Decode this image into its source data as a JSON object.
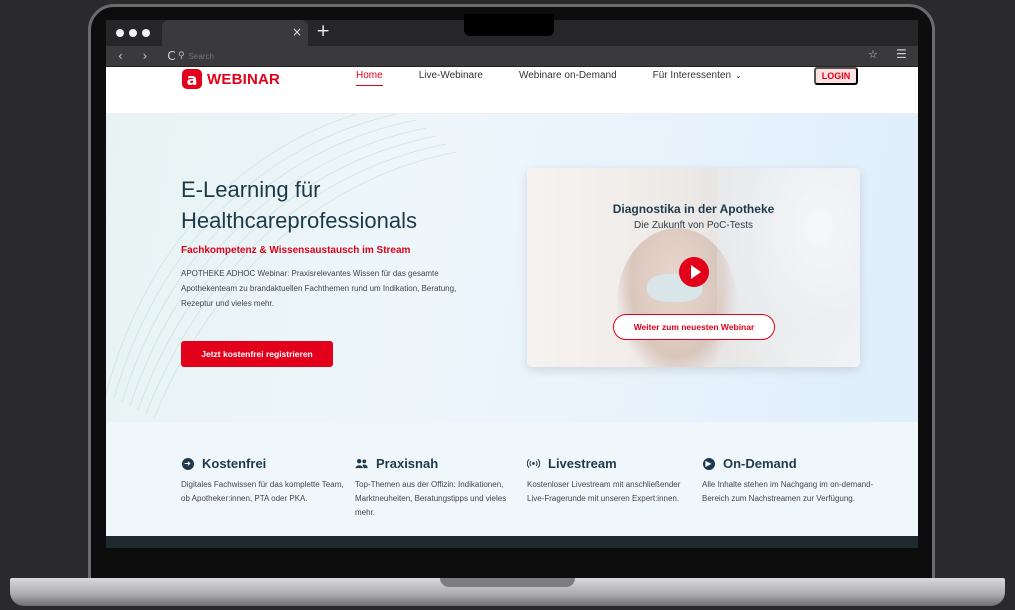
{
  "browser": {
    "tab_close": "×",
    "new_tab": "+",
    "nav_buttons": "‹ › C",
    "search_placeholder": "Search"
  },
  "header": {
    "logo_mark": "a",
    "logo_text": "WEBINAR",
    "nav": [
      {
        "label": "Home",
        "active": true
      },
      {
        "label": "Live-Webinare"
      },
      {
        "label": "Webinare on-Demand"
      },
      {
        "label": "Für Interessenten"
      }
    ],
    "login_label": "LOGIN"
  },
  "hero": {
    "title_line1": "E-Learning für",
    "title_line2": "Healthcareprofessionals",
    "subtitle": "Fachkompetenz & Wissensaustausch im Stream",
    "description": "APOTHEKE ADHOC Webinar: Praxisrelevantes Wissen für das gesamte Apothekenteam zu brandaktuellen Fachthemen rund um Indikation, Beratung, Rezeptur und vieles mehr.",
    "cta_label": "Jetzt kostenfrei registrieren"
  },
  "video": {
    "title": "Diagnostika in der Apotheke",
    "subtitle": "Die Zukunft von PoC-Tests",
    "button_label": "Weiter zum neuesten Webinar"
  },
  "features": [
    {
      "title": "Kostenfrei",
      "icon": "arrow-right-circle-icon",
      "text": "Digitales Fachwissen für das komplette Team, ob Apotheker:innen, PTA oder PKA."
    },
    {
      "title": "Praxisnah",
      "icon": "users-icon",
      "text": "Top-Themen aus der Offizin: Indikationen, Marktneuheiten, Beratungstipps und vieles mehr."
    },
    {
      "title": "Livestream",
      "icon": "broadcast-icon",
      "text": "Kostenloser Livestream mit anschließender Live-Fragerunde mit unseren Expert:innen."
    },
    {
      "title": "On-Demand",
      "icon": "play-circle-icon",
      "text": "Alle Inhalte stehen im Nachgang im on-demand-Bereich zum Nachstreamen zur Verfügung."
    }
  ],
  "colors": {
    "brand_red": "#e2001a",
    "dark_text": "#1d3a4a",
    "feature_bg": "#f0f7fb"
  }
}
